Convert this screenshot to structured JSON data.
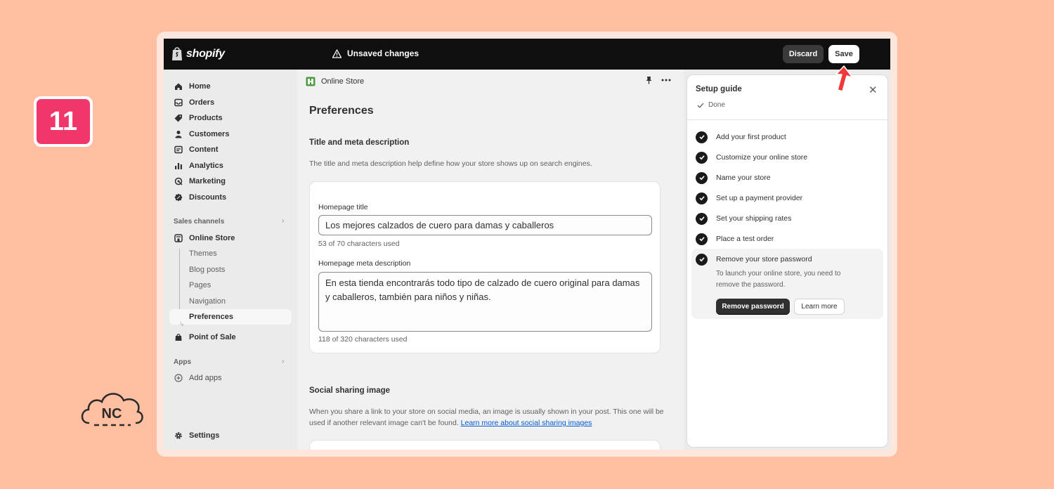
{
  "step_badge": "11",
  "watermark": {
    "text": "NC"
  },
  "topbar": {
    "brand": "shopify",
    "status": "Unsaved changes",
    "discard_label": "Discard",
    "save_label": "Save"
  },
  "sidebar": {
    "items": [
      {
        "label": "Home",
        "icon": "home-icon"
      },
      {
        "label": "Orders",
        "icon": "inbox-icon"
      },
      {
        "label": "Products",
        "icon": "tag-icon"
      },
      {
        "label": "Customers",
        "icon": "person-icon"
      },
      {
        "label": "Content",
        "icon": "content-icon"
      },
      {
        "label": "Analytics",
        "icon": "bar-chart-icon"
      },
      {
        "label": "Marketing",
        "icon": "target-icon"
      },
      {
        "label": "Discounts",
        "icon": "discount-icon"
      }
    ],
    "sales_channels_label": "Sales channels",
    "online_store_label": "Online Store",
    "online_store_sub": [
      "Themes",
      "Blog posts",
      "Pages",
      "Navigation",
      "Preferences"
    ],
    "point_of_sale_label": "Point of Sale",
    "apps_label": "Apps",
    "add_apps_label": "Add apps",
    "settings_label": "Settings"
  },
  "main": {
    "channel_name": "Online Store",
    "page_title": "Preferences",
    "title_meta": {
      "heading": "Title and meta description",
      "description": "The title and meta description help define how your store shows up on search engines.",
      "homepage_title_label": "Homepage title",
      "homepage_title_value": "Los mejores calzados de cuero para damas y caballeros",
      "homepage_title_count": "53 of 70 characters used",
      "meta_description_label": "Homepage meta description",
      "meta_description_value": "En esta tienda encontrarás todo tipo de calzado de cuero original para damas y caballeros, también para niños y niñas.",
      "meta_description_count": "118 of 320 characters used"
    },
    "social_sharing": {
      "heading": "Social sharing image",
      "description": "When you share a link to your store on social media, an image is usually shown in your post. This one will be used if another relevant image can't be found.",
      "link_text": "Learn more about social sharing images"
    }
  },
  "setup_guide": {
    "title": "Setup guide",
    "status": "Done",
    "tasks": [
      "Add your first product",
      "Customize your online store",
      "Name your store",
      "Set up a payment provider",
      "Set your shipping rates",
      "Place a test order"
    ],
    "active_task": {
      "label": "Remove your store password",
      "description": "To launch your online store, you need to remove the password.",
      "primary_button": "Remove password",
      "secondary_button": "Learn more"
    }
  }
}
